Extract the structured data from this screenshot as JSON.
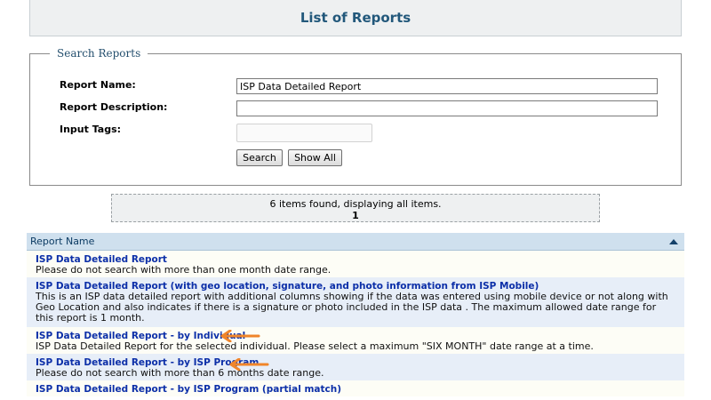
{
  "page": {
    "title": "List of Reports"
  },
  "search": {
    "legend": "Search Reports",
    "report_name_label": "Report Name:",
    "report_name_value": "ISP Data Detailed Report",
    "report_description_label": "Report Description:",
    "report_description_value": "",
    "input_tags_label": "Input Tags:",
    "search_button": "Search",
    "show_all_button": "Show All"
  },
  "pager": {
    "summary": "6 items found, displaying all items.",
    "page": "1"
  },
  "table": {
    "column_header": "Report Name",
    "rows": [
      {
        "title": "ISP Data Detailed Report",
        "desc": "Please do not search with more than one month date range."
      },
      {
        "title": "ISP Data Detailed Report (with geo location, signature, and photo information from ISP Mobile)",
        "desc": "This is an ISP data detailed report with additional columns showing if the data was entered using mobile device or not along with Geo Location and also indicates if there is a signature or photo included in the ISP data . The maximum allowed date range for this report is 1 month."
      },
      {
        "title": "ISP Data Detailed Report - by Individual",
        "desc": "ISP Data Detailed Report for the selected individual. Please select a maximum \"SIX MONTH\" date range at a time."
      },
      {
        "title": "ISP Data Detailed Report - by ISP Program",
        "desc": "Please do not search with more than 6 months date range."
      },
      {
        "title": "ISP Data Detailed Report - by ISP Program (partial match)",
        "desc": ""
      }
    ]
  },
  "colors": {
    "title": "#22587b",
    "link": "#0c2fa8",
    "header_bg": "#cfe0ee",
    "arrow": "#f0852a"
  }
}
